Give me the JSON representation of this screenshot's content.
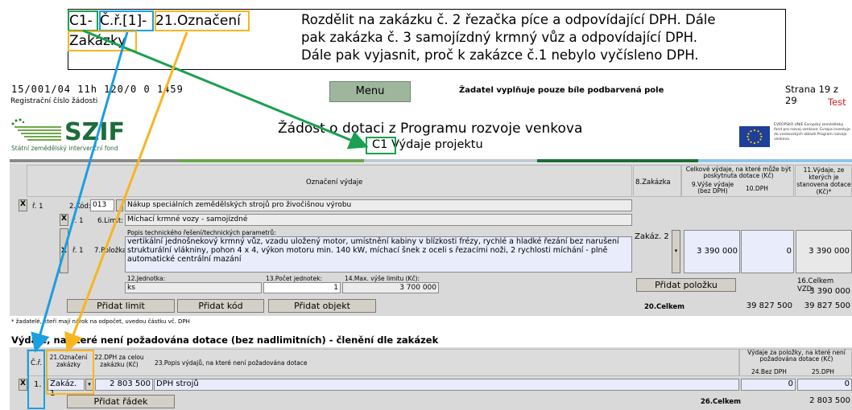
{
  "annotation": {
    "tag_c1": "C1-",
    "tag_cr": "Č.ř.[1]-",
    "tag_21": "21.Označení",
    "tag_zakazky": "Zakázky",
    "note_lines": [
      "Rozdělit na zakázku č. 2 řezačka píce a odpovídající DPH. Dále",
      "pak zakázka č. 3 samojízdný krmný vůz a odpovídající DPH.",
      "Dále pak vyjasnit, proč k zakázce č.1 nebylo vyčísleno DPH."
    ],
    "colors": {
      "green": "#1aa050",
      "blue": "#1a9fe0",
      "orange": "#f7b520"
    }
  },
  "header": {
    "registration_number": "15/001/04 11h 120/0 0 1459",
    "registration_label": "Registrační číslo žádosti",
    "menu_label": "Menu",
    "applicant_note": "Žadatel vyplňuje pouze bíle podbarvená pole",
    "page_info": "Strana 19 z 29",
    "test_label": "Test",
    "logo_text": "SZIF",
    "logo_subtitle": "Státní zemědělský intervenční fond",
    "title": "Žádost o dotaci z Programu rozvoje venkova",
    "subtitle": "C1 Výdaje projektu",
    "eu_text": "EVROPSKÁ UNIE Evropský zemědělský fond pro rozvoj venkova: Evropa investuje do venkovských oblastí Program rozvoje venkova"
  },
  "table": {
    "col_oznaceni": "Označení výdaje",
    "col_zakazka": "8.Zakázka",
    "col_celkove": "Celkové výdaje, na které může být poskytnuta dotace (Kč)",
    "col_vyse": "9.Výše výdaje (bez DPH)",
    "col_dph": "10.DPH",
    "col_11": "11.Výdaje, ze kterých je stanovena dotace (Kč)*",
    "row1_x": "X",
    "row1_num": "ř. 1",
    "row1_kod_label": "2.Kód:",
    "row1_kod": "013",
    "row1_text": "Nákup speciálních zemědělských strojů pro živočišnou výrobu",
    "row2_x": "X",
    "row2_num": "ř. 1",
    "row2_label": "6.Limit:",
    "row2_text": "Míchací krmné vozy - samojízdné",
    "row3_x": "X",
    "row3_num": "ř. 1",
    "row3_label": "7.Položka",
    "row3_tech_label": "Popis technického řešení/technických parametrů:",
    "row3_text": "vertikální jednošnekový krmný vůz, vzadu uložený motor, umístnění kabiny v blízkosti frézy, rychlé a hladké řezání bez narušení strukturální vlákniny, pohon 4 x 4, výkon motoru min. 140 kW, míchací šnek z oceli s řezacími noži, 2 rychlosti míchání - plně automatické centrální mazání",
    "zakazka_value": "Zakáz. 2",
    "vyse_value": "3 390 000",
    "dph_value": "0",
    "col11_value": "3 390 000",
    "jednotka_label": "12.Jednotka:",
    "jednotka_value": "ks",
    "pocet_label": "13.Počet jednotek:",
    "pocet_value": "1",
    "max_label": "14.Max. výše limitu (Kč):",
    "max_value": "3 700 000",
    "add_item": "Přidat položku",
    "celkem_vzd_label": "16.Celkem VZD:",
    "celkem_vzd_value": "3 390 000",
    "add_limit": "Přidat limit",
    "add_code": "Přidat kód",
    "add_object": "Přidat objekt",
    "celkem20_label": "20.Celkem",
    "celkem20_a": "39 827 500",
    "celkem20_b": "39 827 500",
    "footnote": "* žadatelé, kteří mají nárok na odpočet, uvedou částku vč. DPH"
  },
  "section2": {
    "title": "Výdaje, na které není požadována dotace (bez nadlimitních) - členění dle zakázek",
    "col_cr": "Č.ř.",
    "col_21": "21.Označení zakázky",
    "col_22": "22.DPH za celou zakázku (Kč)",
    "col_23": "23.Popis výdajů, na které není požadována dotace",
    "col_vydaje": "Výdaje za položky, na které není požadována dotace (Kč)",
    "col_24": "24.Bez DPH",
    "col_25": "25.DPH",
    "row_x": "X",
    "row_num": "1.",
    "row_zakazka": "Zakáz. 1",
    "row_dph": "2 803 500",
    "row_popis": "DPH strojů",
    "row_24": "0",
    "row_25": "0",
    "add_row": "Přidat řádek",
    "celkem26_label": "26.Celkem",
    "celkem26_value": "2 803 500"
  }
}
